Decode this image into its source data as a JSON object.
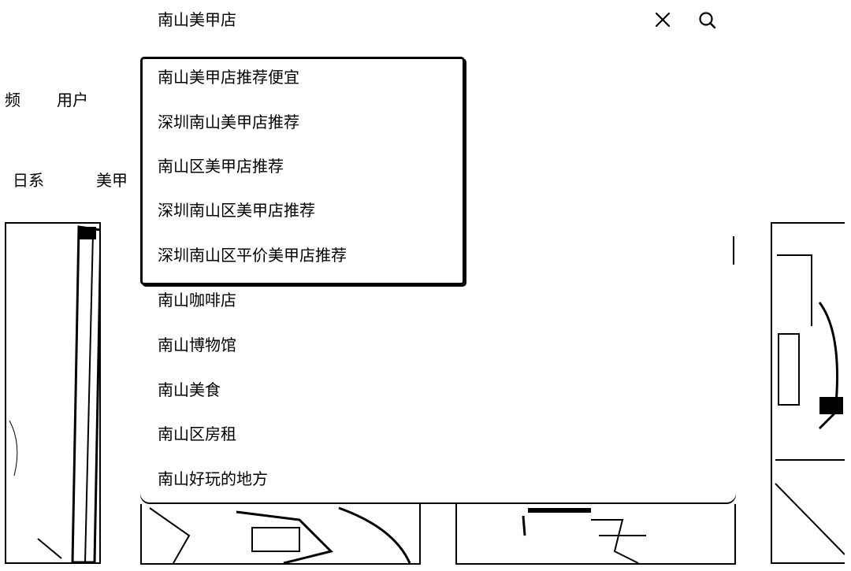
{
  "search": {
    "query": "南山美甲店"
  },
  "tabs": [
    {
      "label": "频"
    },
    {
      "label": "用户"
    }
  ],
  "categories": [
    {
      "label": "日系"
    },
    {
      "label": "美甲"
    }
  ],
  "suggestions": [
    "南山美甲店推荐便宜",
    "深圳南山美甲店推荐",
    "南山区美甲店推荐",
    "深圳南山区美甲店推荐",
    "深圳南山区平价美甲店推荐",
    "南山咖啡店",
    "南山博物馆",
    "南山美食",
    "南山区房租",
    "南山好玩的地方"
  ],
  "icons": {
    "clear": "close-icon",
    "search": "search-icon"
  }
}
